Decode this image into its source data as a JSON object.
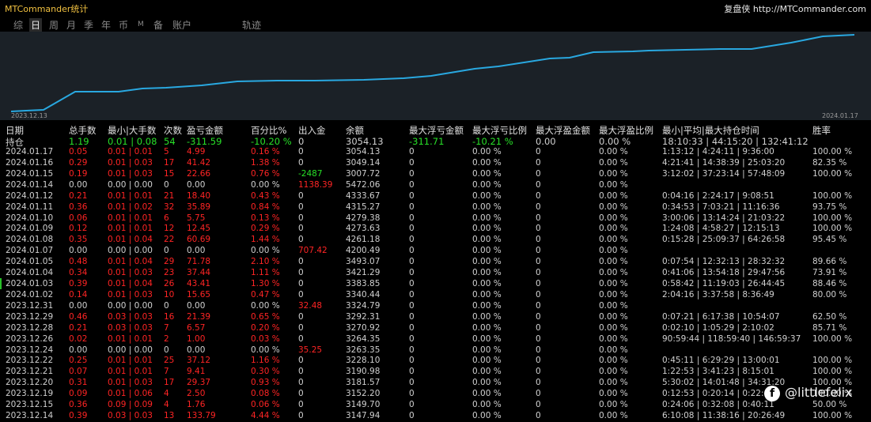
{
  "app": {
    "title": "MTCommander统计",
    "brand": "复盘侠 http://MTCommander.com"
  },
  "tabs": [
    {
      "label": "综",
      "active": false
    },
    {
      "label": "日",
      "active": true
    },
    {
      "label": "周",
      "active": false
    },
    {
      "label": "月",
      "active": false
    },
    {
      "label": "季",
      "active": false
    },
    {
      "label": "年",
      "active": false
    },
    {
      "label": "币",
      "active": false
    },
    {
      "label": "M",
      "active": false
    },
    {
      "label": "备",
      "active": false
    },
    {
      "label": "账户",
      "active": false
    },
    {
      "label": "轨迹",
      "active": false
    }
  ],
  "chart": {
    "start_label": "2023.12.13",
    "end_label": "2024.01.17",
    "line_color": "#29a8e0",
    "bg_color": "#1b2127"
  },
  "columns": [
    "日期",
    "总手数",
    "最小|大手数",
    "次数",
    "盈亏金额",
    "百分比%",
    "出入金",
    "余额",
    "最大浮亏金额",
    "最大浮亏比例",
    "最大浮盈金额",
    "最大浮盈比例",
    "最小|平均|最大持仓时间",
    "胜率"
  ],
  "summary": {
    "date": "持仓",
    "lots": "1.19",
    "minmax": "0.01 | 0.08",
    "count": "54",
    "pnl": "-311.59",
    "pct": "-10.20 %",
    "flow": "0",
    "balance": "3054.13",
    "max_float_loss": "-311.71",
    "max_float_loss_pct": "-10.21 %",
    "max_float_profit": "0.00",
    "max_float_profit_pct": "0.00 %",
    "hold_time": "18:10:33 | 44:15:20 | 132:41:12",
    "win": ""
  },
  "rows": [
    {
      "date": "2024.01.17",
      "lots": "0.05",
      "minmax": "0.01 | 0.01",
      "count": "5",
      "pnl": "4.99",
      "pct": "0.16 %",
      "flow": "0",
      "balance": "3054.13",
      "mfl": "0",
      "mflp": "0.00 %",
      "mfp": "0",
      "mfpp": "0.00 %",
      "hold": "1:13:12 | 4:24:11 | 9:36:00",
      "win": "100.00 %"
    },
    {
      "date": "2024.01.16",
      "lots": "0.29",
      "minmax": "0.01 | 0.03",
      "count": "17",
      "pnl": "41.42",
      "pct": "1.38 %",
      "flow": "0",
      "balance": "3049.14",
      "mfl": "0",
      "mflp": "0.00 %",
      "mfp": "0",
      "mfpp": "0.00 %",
      "hold": "4:21:41 | 14:38:39 | 25:03:20",
      "win": "82.35 %"
    },
    {
      "date": "2024.01.15",
      "lots": "0.19",
      "minmax": "0.01 | 0.03",
      "count": "15",
      "pnl": "22.66",
      "pct": "0.76 %",
      "flow": "-2487",
      "balance": "3007.72",
      "mfl": "0",
      "mflp": "0.00 %",
      "mfp": "0",
      "mfpp": "0.00 %",
      "hold": "3:12:02 | 37:23:14 | 57:48:09",
      "win": "100.00 %"
    },
    {
      "date": "2024.01.14",
      "lots": "0.00",
      "minmax": "0.00 | 0.00",
      "count": "0",
      "pnl": "0.00",
      "pct": "0.00 %",
      "flow": "1138.39",
      "balance": "5472.06",
      "mfl": "0",
      "mflp": "0.00 %",
      "mfp": "0",
      "mfpp": "0.00 %",
      "hold": "",
      "win": ""
    },
    {
      "date": "2024.01.12",
      "lots": "0.21",
      "minmax": "0.01 | 0.01",
      "count": "21",
      "pnl": "18.40",
      "pct": "0.43 %",
      "flow": "0",
      "balance": "4333.67",
      "mfl": "0",
      "mflp": "0.00 %",
      "mfp": "0",
      "mfpp": "0.00 %",
      "hold": "0:04:16 | 2:24:17 | 9:08:51",
      "win": "100.00 %"
    },
    {
      "date": "2024.01.11",
      "lots": "0.36",
      "minmax": "0.01 | 0.02",
      "count": "32",
      "pnl": "35.89",
      "pct": "0.84 %",
      "flow": "0",
      "balance": "4315.27",
      "mfl": "0",
      "mflp": "0.00 %",
      "mfp": "0",
      "mfpp": "0.00 %",
      "hold": "0:34:53 | 7:03:21 | 11:16:36",
      "win": "93.75 %"
    },
    {
      "date": "2024.01.10",
      "lots": "0.06",
      "minmax": "0.01 | 0.01",
      "count": "6",
      "pnl": "5.75",
      "pct": "0.13 %",
      "flow": "0",
      "balance": "4279.38",
      "mfl": "0",
      "mflp": "0.00 %",
      "mfp": "0",
      "mfpp": "0.00 %",
      "hold": "3:00:06 | 13:14:24 | 21:03:22",
      "win": "100.00 %"
    },
    {
      "date": "2024.01.09",
      "lots": "0.12",
      "minmax": "0.01 | 0.01",
      "count": "12",
      "pnl": "12.45",
      "pct": "0.29 %",
      "flow": "0",
      "balance": "4273.63",
      "mfl": "0",
      "mflp": "0.00 %",
      "mfp": "0",
      "mfpp": "0.00 %",
      "hold": "1:24:08 | 4:58:27 | 12:15:13",
      "win": "100.00 %"
    },
    {
      "date": "2024.01.08",
      "lots": "0.35",
      "minmax": "0.01 | 0.04",
      "count": "22",
      "pnl": "60.69",
      "pct": "1.44 %",
      "flow": "0",
      "balance": "4261.18",
      "mfl": "0",
      "mflp": "0.00 %",
      "mfp": "0",
      "mfpp": "0.00 %",
      "hold": "0:15:28 | 25:09:37 | 64:26:58",
      "win": "95.45 %"
    },
    {
      "date": "2024.01.07",
      "lots": "0.00",
      "minmax": "0.00 | 0.00",
      "count": "0",
      "pnl": "0.00",
      "pct": "0.00 %",
      "flow": "707.42",
      "balance": "4200.49",
      "mfl": "0",
      "mflp": "0.00 %",
      "mfp": "0",
      "mfpp": "0.00 %",
      "hold": "",
      "win": ""
    },
    {
      "date": "2024.01.05",
      "lots": "0.48",
      "minmax": "0.01 | 0.04",
      "count": "29",
      "pnl": "71.78",
      "pct": "2.10 %",
      "flow": "0",
      "balance": "3493.07",
      "mfl": "0",
      "mflp": "0.00 %",
      "mfp": "0",
      "mfpp": "0.00 %",
      "hold": "0:07:54 | 12:32:13 | 28:32:32",
      "win": "89.66 %"
    },
    {
      "date": "2024.01.04",
      "lots": "0.34",
      "minmax": "0.01 | 0.03",
      "count": "23",
      "pnl": "37.44",
      "pct": "1.11 %",
      "flow": "0",
      "balance": "3421.29",
      "mfl": "0",
      "mflp": "0.00 %",
      "mfp": "0",
      "mfpp": "0.00 %",
      "hold": "0:41:06 | 13:54:18 | 29:47:56",
      "win": "73.91 %"
    },
    {
      "date": "2024.01.03",
      "lots": "0.39",
      "minmax": "0.01 | 0.04",
      "count": "26",
      "pnl": "43.41",
      "pct": "1.30 %",
      "flow": "0",
      "balance": "3383.85",
      "mfl": "0",
      "mflp": "0.00 %",
      "mfp": "0",
      "mfpp": "0.00 %",
      "hold": "0:58:42 | 11:19:03 | 26:44:45",
      "win": "88.46 %"
    },
    {
      "date": "2024.01.02",
      "lots": "0.14",
      "minmax": "0.01 | 0.03",
      "count": "10",
      "pnl": "15.65",
      "pct": "0.47 %",
      "flow": "0",
      "balance": "3340.44",
      "mfl": "0",
      "mflp": "0.00 %",
      "mfp": "0",
      "mfpp": "0.00 %",
      "hold": "2:04:16 | 3:37:58 | 8:36:49",
      "win": "80.00 %"
    },
    {
      "date": "2023.12.31",
      "lots": "0.00",
      "minmax": "0.00 | 0.00",
      "count": "0",
      "pnl": "0.00",
      "pct": "0.00 %",
      "flow": "32.48",
      "balance": "3324.79",
      "mfl": "0",
      "mflp": "0.00 %",
      "mfp": "0",
      "mfpp": "0.00 %",
      "hold": "",
      "win": ""
    },
    {
      "date": "2023.12.29",
      "lots": "0.46",
      "minmax": "0.03 | 0.03",
      "count": "16",
      "pnl": "21.39",
      "pct": "0.65 %",
      "flow": "0",
      "balance": "3292.31",
      "mfl": "0",
      "mflp": "0.00 %",
      "mfp": "0",
      "mfpp": "0.00 %",
      "hold": "0:07:21 | 6:17:38 | 10:54:07",
      "win": "62.50 %"
    },
    {
      "date": "2023.12.28",
      "lots": "0.21",
      "minmax": "0.03 | 0.03",
      "count": "7",
      "pnl": "6.57",
      "pct": "0.20 %",
      "flow": "0",
      "balance": "3270.92",
      "mfl": "0",
      "mflp": "0.00 %",
      "mfp": "0",
      "mfpp": "0.00 %",
      "hold": "0:02:10 | 1:05:29 | 2:10:02",
      "win": "85.71 %"
    },
    {
      "date": "2023.12.26",
      "lots": "0.02",
      "minmax": "0.01 | 0.01",
      "count": "2",
      "pnl": "1.00",
      "pct": "0.03 %",
      "flow": "0",
      "balance": "3264.35",
      "mfl": "0",
      "mflp": "0.00 %",
      "mfp": "0",
      "mfpp": "0.00 %",
      "hold": "90:59:44 | 118:59:40 | 146:59:37",
      "win": "100.00 %"
    },
    {
      "date": "2023.12.24",
      "lots": "0.00",
      "minmax": "0.00 | 0.00",
      "count": "0",
      "pnl": "0.00",
      "pct": "0.00 %",
      "flow": "35.25",
      "balance": "3263.35",
      "mfl": "0",
      "mflp": "0.00 %",
      "mfp": "0",
      "mfpp": "0.00 %",
      "hold": "",
      "win": ""
    },
    {
      "date": "2023.12.22",
      "lots": "0.25",
      "minmax": "0.01 | 0.01",
      "count": "25",
      "pnl": "37.12",
      "pct": "1.16 %",
      "flow": "0",
      "balance": "3228.10",
      "mfl": "0",
      "mflp": "0.00 %",
      "mfp": "0",
      "mfpp": "0.00 %",
      "hold": "0:45:11 | 6:29:29 | 13:00:01",
      "win": "100.00 %"
    },
    {
      "date": "2023.12.21",
      "lots": "0.07",
      "minmax": "0.01 | 0.01",
      "count": "7",
      "pnl": "9.41",
      "pct": "0.30 %",
      "flow": "0",
      "balance": "3190.98",
      "mfl": "0",
      "mflp": "0.00 %",
      "mfp": "0",
      "mfpp": "0.00 %",
      "hold": "1:22:53 | 3:41:23 | 8:15:01",
      "win": "100.00 %"
    },
    {
      "date": "2023.12.20",
      "lots": "0.31",
      "minmax": "0.01 | 0.03",
      "count": "17",
      "pnl": "29.37",
      "pct": "0.93 %",
      "flow": "0",
      "balance": "3181.57",
      "mfl": "0",
      "mflp": "0.00 %",
      "mfp": "0",
      "mfpp": "0.00 %",
      "hold": "5:30:02 | 14:01:48 | 34:31:20",
      "win": "100.00 %"
    },
    {
      "date": "2023.12.19",
      "lots": "0.09",
      "minmax": "0.01 | 0.06",
      "count": "4",
      "pnl": "2.50",
      "pct": "0.08 %",
      "flow": "0",
      "balance": "3152.20",
      "mfl": "0",
      "mflp": "0.00 %",
      "mfp": "0",
      "mfpp": "0.00 %",
      "hold": "0:12:53 | 0:20:14 | 0:22:46",
      "win": "100.00 %"
    },
    {
      "date": "2023.12.15",
      "lots": "0.36",
      "minmax": "0.09 | 0.09",
      "count": "4",
      "pnl": "1.76",
      "pct": "0.06 %",
      "flow": "0",
      "balance": "3149.70",
      "mfl": "0",
      "mflp": "0.00 %",
      "mfp": "0",
      "mfpp": "0.00 %",
      "hold": "0:24:06 | 0:32:08 | 0:40:11",
      "win": "50.00 %"
    },
    {
      "date": "2023.12.14",
      "lots": "0.39",
      "minmax": "0.03 | 0.03",
      "count": "13",
      "pnl": "133.79",
      "pct": "4.44 %",
      "flow": "0",
      "balance": "3147.94",
      "mfl": "0",
      "mflp": "0.00 %",
      "mfp": "0",
      "mfpp": "0.00 %",
      "hold": "6:10:08 | 11:38:16 | 20:26:49",
      "win": "100.00 %"
    }
  ],
  "watermark": {
    "icon": "facebook-icon",
    "text": "@littlefelix"
  }
}
